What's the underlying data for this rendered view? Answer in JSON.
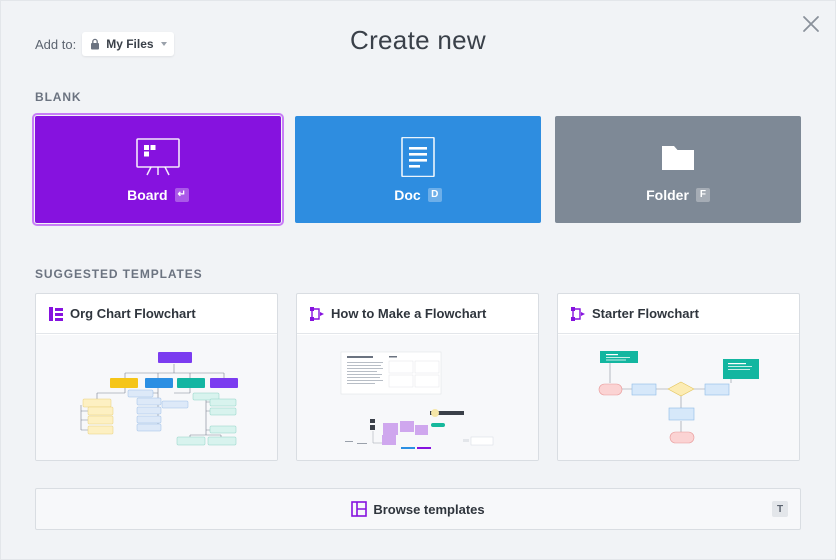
{
  "header": {
    "add_to_label": "Add to:",
    "location": "My Files",
    "title": "Create new"
  },
  "sections": {
    "blank": "BLANK",
    "templates": "SUGGESTED TEMPLATES"
  },
  "blank_items": [
    {
      "label": "Board",
      "shortcut": "↵",
      "color": "#8612df"
    },
    {
      "label": "Doc",
      "shortcut": "D",
      "color": "#2e8de0"
    },
    {
      "label": "Folder",
      "shortcut": "F",
      "color": "#7e8996"
    }
  ],
  "templates": [
    {
      "title": "Org Chart Flowchart"
    },
    {
      "title": "How to Make a Flowchart"
    },
    {
      "title": "Starter Flowchart"
    }
  ],
  "browse": {
    "label": "Browse templates",
    "shortcut": "T"
  },
  "colors": {
    "accent": "#8612df"
  }
}
